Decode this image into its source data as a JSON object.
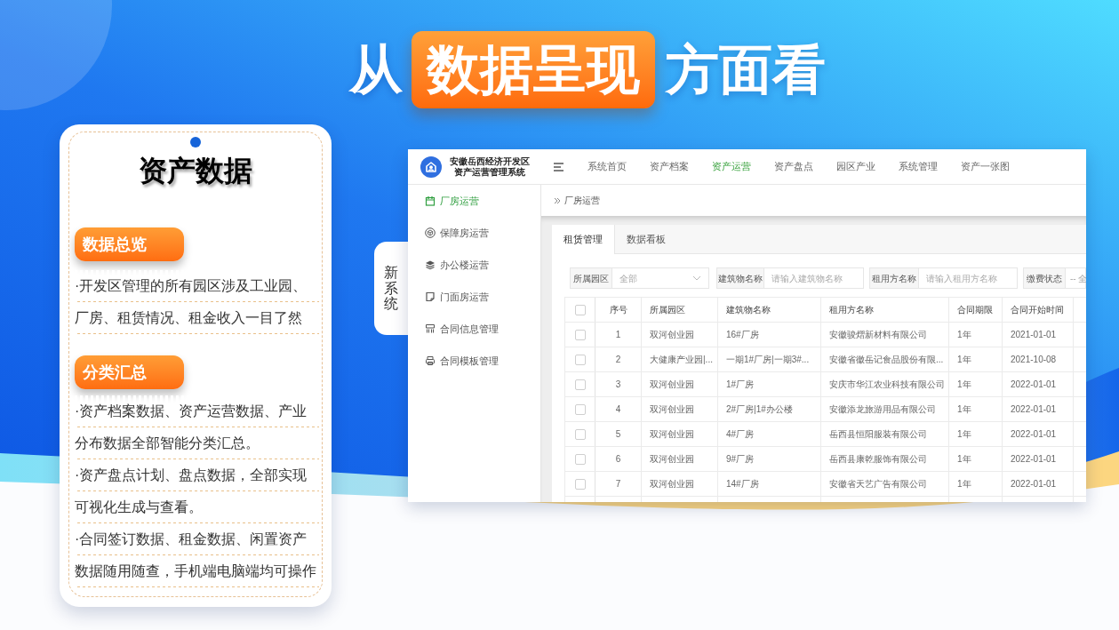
{
  "title": {
    "prefix": "从",
    "highlight": "数据呈现",
    "suffix": "方面看"
  },
  "card": {
    "title": "资产数据",
    "sections": [
      {
        "heading": "数据总览",
        "paragraphs": [
          "·开发区管理的所有园区涉及工业园、厂房、租赁情况、租金收入一目了然"
        ]
      },
      {
        "heading": "分类汇总",
        "paragraphs": [
          "·资产档案数据、资产运营数据、产业分布数据全部智能分类汇总。",
          "·资产盘点计划、盘点数据，全部实现可视化生成与查看。",
          "·合同签订数据、租金数据、闲置资产数据随用随查，手机端电脑端均可操作"
        ]
      }
    ]
  },
  "side_tab": {
    "label": "新系统"
  },
  "app": {
    "header": {
      "title_lines": [
        "安徽岳西经济开发区",
        "资产运营管理系统"
      ],
      "nav": [
        {
          "label": "系统首页",
          "selected": false
        },
        {
          "label": "资产档案",
          "selected": false
        },
        {
          "label": "资产运营",
          "selected": true
        },
        {
          "label": "资产盘点",
          "selected": false
        },
        {
          "label": "园区产业",
          "selected": false
        },
        {
          "label": "系统管理",
          "selected": false
        },
        {
          "label": "资产一张图",
          "selected": false
        }
      ]
    },
    "sidebar": [
      {
        "label": "厂房运营",
        "selected": true
      },
      {
        "label": "保障房运营",
        "selected": false
      },
      {
        "label": "办公楼运营",
        "selected": false
      },
      {
        "label": "门面房运营",
        "selected": false
      },
      {
        "label": "合同信息管理",
        "selected": false
      },
      {
        "label": "合同模板管理",
        "selected": false
      }
    ],
    "breadcrumb": "厂房运营",
    "tabs": [
      {
        "label": "租赁管理",
        "selected": true
      },
      {
        "label": "数据看板",
        "selected": false
      }
    ],
    "filters": [
      {
        "label": "所属园区",
        "kind": "select",
        "value": "全部",
        "caret": true
      },
      {
        "label": "建筑物名称",
        "kind": "input",
        "placeholder": "请输入建筑物名称"
      },
      {
        "label": "租用方名称",
        "kind": "input",
        "placeholder": "请输入租用方名称"
      },
      {
        "label": "缴费状态",
        "kind": "select",
        "value": "-- 全",
        "caret": false
      }
    ],
    "table": {
      "header_checked": false,
      "columns": [
        "序号",
        "所属园区",
        "建筑物名称",
        "租用方名称",
        "合同期限",
        "合同开始时间"
      ],
      "rows": [
        {
          "checked": false,
          "cells": [
            "1",
            "双河创业园",
            "16#厂房",
            "安徽骏熠新材料有限公司",
            "1年",
            "2021-01-01"
          ]
        },
        {
          "checked": false,
          "cells": [
            "2",
            "大健康产业园|...",
            "一期1#厂房|一期3#...",
            "安徽省徽岳记食品股份有限...",
            "1年",
            "2021-10-08"
          ]
        },
        {
          "checked": false,
          "cells": [
            "3",
            "双河创业园",
            "1#厂房",
            "安庆市华江农业科技有限公司",
            "1年",
            "2022-01-01"
          ]
        },
        {
          "checked": false,
          "cells": [
            "4",
            "双河创业园",
            "2#厂房|1#办公楼",
            "安徽添龙旅游用品有限公司",
            "1年",
            "2022-01-01"
          ]
        },
        {
          "checked": false,
          "cells": [
            "5",
            "双河创业园",
            "4#厂房",
            "岳西县恒阳服装有限公司",
            "1年",
            "2022-01-01"
          ]
        },
        {
          "checked": false,
          "cells": [
            "6",
            "双河创业园",
            "9#厂房",
            "岳西县康乾服饰有限公司",
            "1年",
            "2022-01-01"
          ]
        },
        {
          "checked": false,
          "cells": [
            "7",
            "双河创业园",
            "14#厂房",
            "安徽省天艺广告有限公司",
            "1年",
            "2022-01-01"
          ]
        }
      ]
    }
  }
}
